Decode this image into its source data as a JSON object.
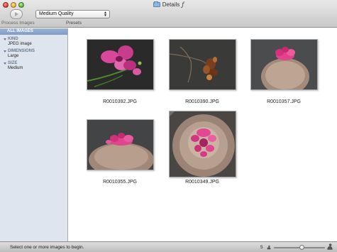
{
  "window": {
    "title": "Details",
    "title_suffix": "ƒ"
  },
  "toolbar": {
    "process_label": "Process Images",
    "preset_value": "Medium Quality",
    "preset_label": "Presets"
  },
  "sidebar": {
    "header": "ALL IMAGES",
    "groups": [
      {
        "title": "KIND",
        "value": "JPEG image"
      },
      {
        "title": "DIMENSIONS",
        "value": "Large"
      },
      {
        "title": "SIZE",
        "value": "Medium"
      }
    ]
  },
  "images": [
    {
      "filename": "R0010392.JPG",
      "subject": "orchid"
    },
    {
      "filename": "R0010390.JPG",
      "subject": "dried-seed-pod"
    },
    {
      "filename": "R0010357.JPG",
      "subject": "cactus-side"
    },
    {
      "filename": "R0010355.JPG",
      "subject": "cactus-wide"
    },
    {
      "filename": "R0010349.JPG",
      "subject": "cactus-top"
    }
  ],
  "status": {
    "message": "Select one or more images to begin.",
    "count": "5",
    "zoom_level": 0.55
  },
  "colors": {
    "sidebar_bg": "#dfe5ee",
    "sidebar_header": "#8aa4cc",
    "chrome": "#d4d4d4"
  }
}
